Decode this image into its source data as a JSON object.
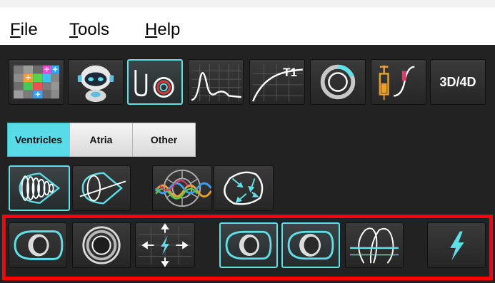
{
  "menu": {
    "file": {
      "mnemonic": "F",
      "rest": "ile"
    },
    "tools": {
      "mnemonic": "T",
      "rest": "ools"
    },
    "help": {
      "mnemonic": "H",
      "rest": "elp"
    }
  },
  "toolbar": {
    "t1_label": "T1",
    "three_d_label": "3D/4D"
  },
  "tabs": {
    "ventricles": "Ventricles",
    "atria": "Atria",
    "other": "Other"
  },
  "colors": {
    "accent": "#5fe0e8",
    "highlight_box": "#ff0000",
    "panel_bg": "#222222"
  },
  "icons": {
    "app_toolbar": [
      "image-viewer-grid-icon",
      "virtual-assistant-robot-icon",
      "flow-analysis-icon",
      "time-signal-curve-icon",
      "t1-mapping-icon",
      "myocardial-ring-icon",
      "contrast-injection-icon",
      "3d-4d-icon"
    ],
    "ventricle_tools": [
      "short-axis-stack-icon",
      "long-axis-ventricle-icon",
      "regional-segment-icon",
      "axis-alignment-icon"
    ],
    "highlighted_tools": [
      "lv-endo-epi-contour-icon",
      "concentric-ring-icon",
      "move-center-icon",
      "lv-contour-selected-icon",
      "rv-contour-selected-icon",
      "valve-plane-icon",
      "auto-segmentation-lightning-icon"
    ]
  }
}
